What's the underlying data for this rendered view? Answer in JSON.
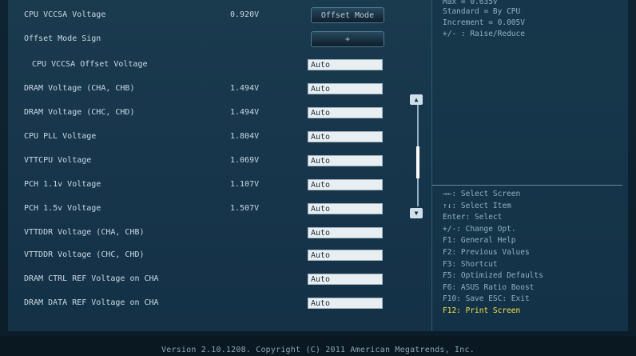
{
  "settings": [
    {
      "label": "CPU VCCSA Voltage",
      "value": "0.920V",
      "control": "Offset Mode",
      "control_type": "button"
    },
    {
      "label": "Offset Mode Sign",
      "value": "",
      "control": "+",
      "control_type": "button"
    },
    {
      "label": "CPU VCCSA Offset Voltage",
      "value": "",
      "control": "Auto",
      "control_type": "field",
      "sub": true
    },
    {
      "label": "DRAM Voltage (CHA, CHB)",
      "value": "1.494V",
      "control": "Auto",
      "control_type": "field"
    },
    {
      "label": "DRAM Voltage (CHC, CHD)",
      "value": "1.494V",
      "control": "Auto",
      "control_type": "field"
    },
    {
      "label": "CPU PLL Voltage",
      "value": "1.804V",
      "control": "Auto",
      "control_type": "field"
    },
    {
      "label": "VTTCPU Voltage",
      "value": "1.069V",
      "control": "Auto",
      "control_type": "field"
    },
    {
      "label": "PCH 1.1v Voltage",
      "value": "1.107V",
      "control": "Auto",
      "control_type": "field"
    },
    {
      "label": "PCH 1.5v Voltage",
      "value": "1.507V",
      "control": "Auto",
      "control_type": "field"
    },
    {
      "label": "VTTDDR Voltage (CHA, CHB)",
      "value": "",
      "control": "Auto",
      "control_type": "field"
    },
    {
      "label": "VTTDDR Voltage (CHC, CHD)",
      "value": "",
      "control": "Auto",
      "control_type": "field"
    },
    {
      "label": "DRAM CTRL REF Voltage on CHA",
      "value": "",
      "control": "Auto",
      "control_type": "field"
    },
    {
      "label": "DRAM DATA REF Voltage on CHA",
      "value": "",
      "control": "Auto",
      "control_type": "field"
    }
  ],
  "help": {
    "top": [
      "Max = 0.635V",
      "Standard = By CPU",
      "Increment = 0.005V",
      "+/- : Raise/Reduce"
    ],
    "keys": [
      "→←: Select Screen",
      "↑↓: Select Item",
      "Enter: Select",
      "+/-: Change Opt.",
      "F1: General Help",
      "F2: Previous Values",
      "F3: Shortcut",
      "F5: Optimized Defaults",
      "F6: ASUS Ratio Boost",
      "F10: Save  ESC: Exit",
      "F12: Print Screen"
    ]
  },
  "scrollbar": {
    "up_icon": "▲",
    "down_icon": "▼"
  },
  "footer": "Version 2.10.1208. Copyright (C) 2011 American Megatrends, Inc.",
  "colors": {
    "highlight": "#f5e34a",
    "panel": "#1a3a4e"
  }
}
